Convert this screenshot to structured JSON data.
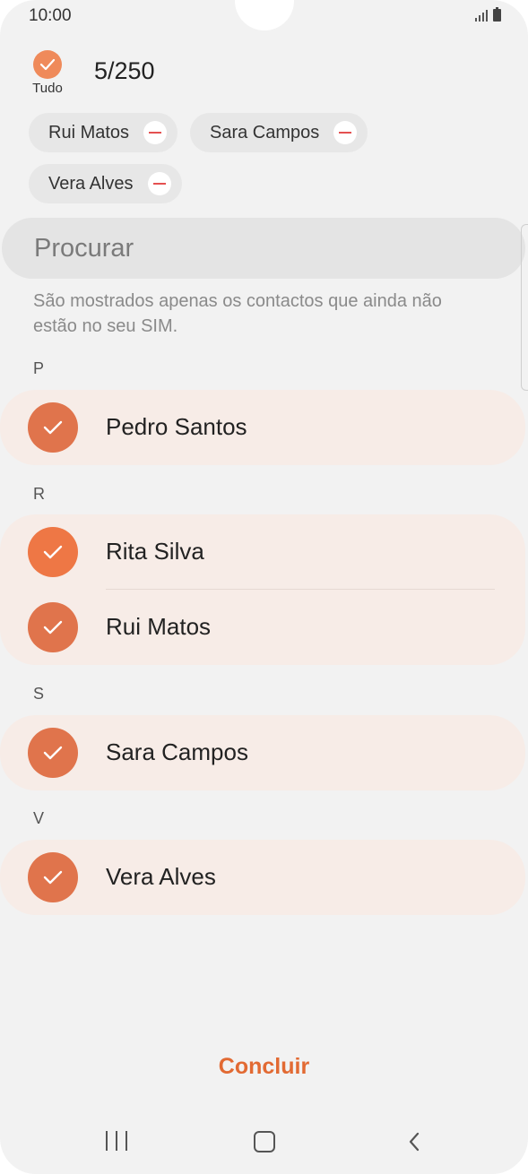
{
  "status_bar": {
    "time": "10:00"
  },
  "header": {
    "select_all_label": "Tudo",
    "count": "5/250"
  },
  "chips": [
    {
      "label": "Rui Matos"
    },
    {
      "label": "Sara Campos"
    },
    {
      "label": "Vera Alves"
    }
  ],
  "search": {
    "placeholder": "Procurar"
  },
  "info_text": "São mostrados apenas os contactos que ainda não estão no seu SIM.",
  "sections": [
    {
      "letter": "P",
      "contacts": [
        {
          "name": "Pedro Santos",
          "selected": true
        }
      ]
    },
    {
      "letter": "R",
      "contacts": [
        {
          "name": "Rita Silva",
          "selected": true
        },
        {
          "name": "Rui Matos",
          "selected": true
        }
      ]
    },
    {
      "letter": "S",
      "contacts": [
        {
          "name": "Sara Campos",
          "selected": true
        }
      ]
    },
    {
      "letter": "V",
      "contacts": [
        {
          "name": "Vera Alves",
          "selected": true
        }
      ]
    }
  ],
  "footer": {
    "done_label": "Concluir"
  },
  "colors": {
    "accent": "#e26a33",
    "check": "#e0744c",
    "row_bg": "#f7ece7"
  },
  "icons": {
    "select_all": "checkmark-icon",
    "chip_remove": "minus-icon",
    "nav_recents": "recents-icon",
    "nav_home": "home-icon",
    "nav_back": "back-icon"
  }
}
